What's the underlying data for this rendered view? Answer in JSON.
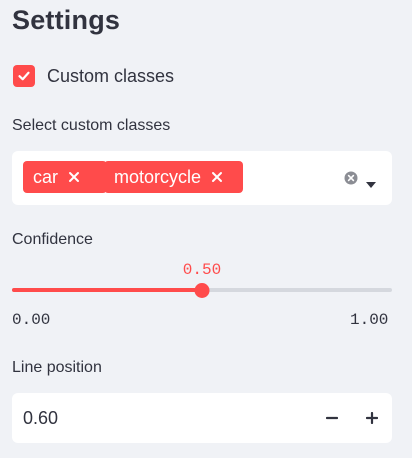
{
  "sidebar": {
    "title": "Settings",
    "custom_classes": {
      "label": "Custom classes",
      "checked": true
    },
    "select_classes": {
      "label": "Select custom classes",
      "tags": [
        "car",
        "motorcycle"
      ],
      "clear_icon": "clear-circle-icon",
      "dropdown_icon": "caret-down-icon"
    },
    "confidence": {
      "label": "Confidence",
      "value": 0.5,
      "value_text": "0.50",
      "min_text": "0.00",
      "max_text": "1.00"
    },
    "line_position": {
      "label": "Line position",
      "value": "0.60",
      "minus_icon": "minus-icon",
      "plus_icon": "plus-icon"
    }
  },
  "colors": {
    "accent": "#ff4b4b",
    "background": "#f0f2f6",
    "text": "#31333f",
    "track": "#d5d8de"
  }
}
